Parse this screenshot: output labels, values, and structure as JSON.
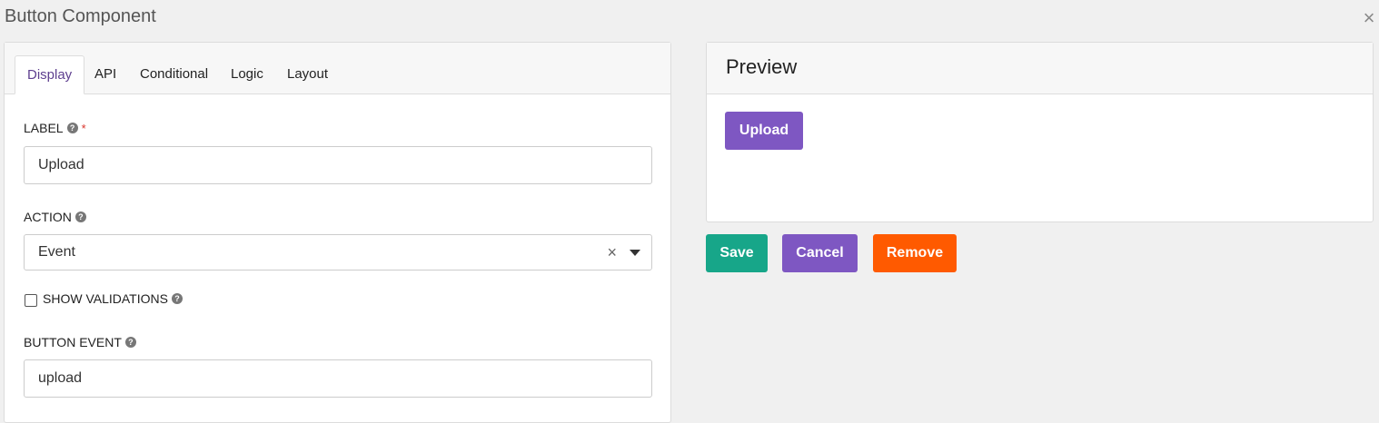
{
  "dialog": {
    "title": "Button Component",
    "close_glyph": "×"
  },
  "tabs": [
    {
      "label": "Display",
      "active": true
    },
    {
      "label": "API"
    },
    {
      "label": "Conditional"
    },
    {
      "label": "Logic"
    },
    {
      "label": "Layout"
    }
  ],
  "form": {
    "label_field": {
      "label": "LABEL",
      "required_mark": "*",
      "value": "Upload"
    },
    "action_field": {
      "label": "ACTION",
      "value": "Event",
      "clear_glyph": "×"
    },
    "show_validations": {
      "label": "SHOW VALIDATIONS",
      "checked": false
    },
    "button_event": {
      "label": "BUTTON EVENT",
      "value": "upload"
    },
    "help_glyph": "?"
  },
  "preview": {
    "title": "Preview",
    "button_label": "Upload"
  },
  "actions": {
    "save_label": "Save",
    "cancel_label": "Cancel",
    "remove_label": "Remove"
  },
  "colors": {
    "purple": "#7e57c2",
    "teal": "#17a689",
    "orange": "#ff5a00",
    "active_tab_text": "#5e3f8f"
  },
  "icons": [
    "close-icon",
    "help-icon",
    "clear-icon",
    "caret-down-icon"
  ]
}
